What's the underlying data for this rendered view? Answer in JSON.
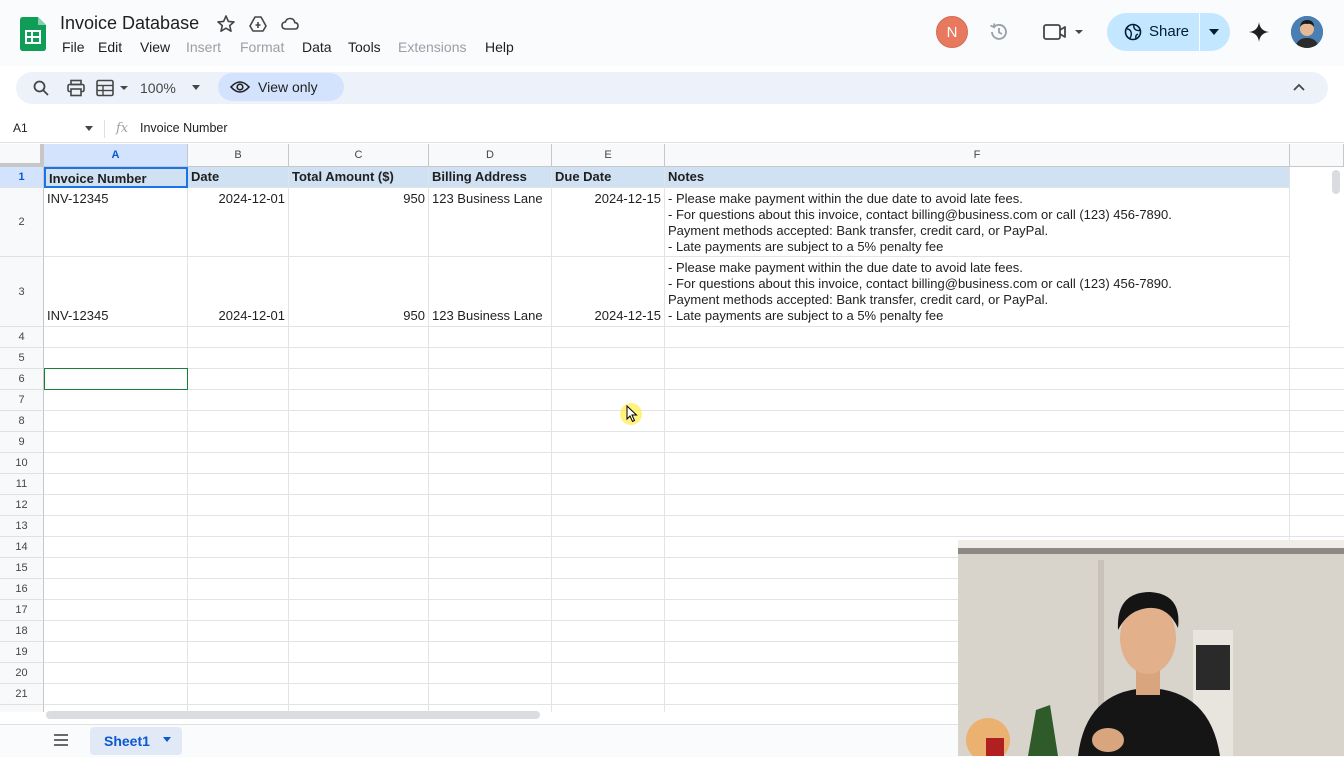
{
  "app": {
    "title": "Invoice Database",
    "menu": [
      "File",
      "Edit",
      "View",
      "Insert",
      "Format",
      "Data",
      "Tools",
      "Extensions",
      "Help"
    ],
    "disabled_menu": [
      "Insert",
      "Format",
      "Extensions"
    ],
    "avatar_initial": "N",
    "share_label": "Share",
    "brand_color": "#0f9d58",
    "accent_color": "#0b57d0"
  },
  "toolbar": {
    "zoom": "100%",
    "view_only_label": "View only"
  },
  "formula_bar": {
    "cell_ref": "A1",
    "fx_label": "fx",
    "value": "Invoice Number"
  },
  "grid": {
    "columns": [
      "A",
      "B",
      "C",
      "D",
      "E",
      "F"
    ],
    "row_numbers": [
      "1",
      "2",
      "3",
      "4",
      "5",
      "6",
      "7",
      "8",
      "9",
      "10",
      "11",
      "12",
      "13",
      "14",
      "15",
      "16",
      "17",
      "18",
      "19",
      "20",
      "21"
    ],
    "headers": [
      "Invoice Number",
      "Date",
      "Total Amount ($)",
      "Billing Address",
      "Due Date",
      "Notes"
    ],
    "rows": [
      {
        "invoice": "INV-12345",
        "date": "2024-12-01",
        "amount": "950",
        "address": "123 Business Lane",
        "due": "2024-12-15",
        "notes": "- Please make payment within the due date to avoid late fees.\n- For questions about this invoice, contact billing@business.com or call (123) 456-7890.\nPayment methods accepted: Bank transfer, credit card, or PayPal.\n- Late payments are subject to a 5% penalty fee"
      },
      {
        "invoice": "INV-12345",
        "date": "2024-12-01",
        "amount": "950",
        "address": "123 Business Lane",
        "due": "2024-12-15",
        "notes": "- Please make payment within the due date to avoid late fees.\n- For questions about this invoice, contact billing@business.com or call (123) 456-7890.\nPayment methods accepted: Bank transfer, credit card, or PayPal.\n- Late payments are subject to a 5% penalty fee"
      }
    ]
  },
  "bottom": {
    "sheet_tab": "Sheet1"
  }
}
